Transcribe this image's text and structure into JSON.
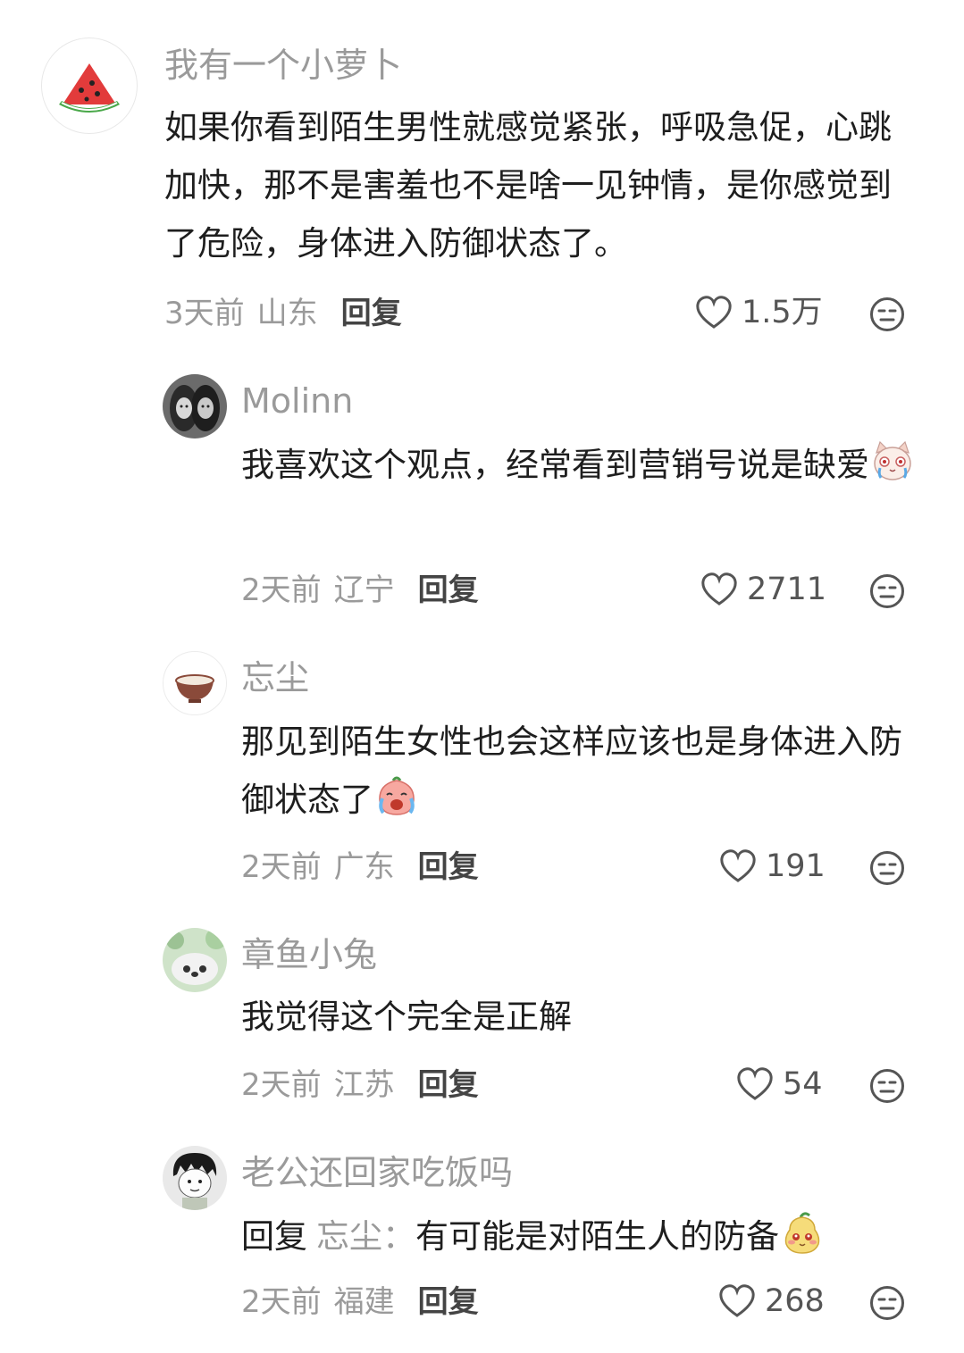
{
  "comments": [
    {
      "username": "我有一个小萝卜",
      "text": "如果你看到陌生男性就感觉紧张，呼吸急促，心跳加快，那不是害羞也不是啥一见钟情，是你感觉到了危险，身体进入防御状态了。",
      "time": "3天前",
      "location": "山东",
      "reply_label": "回复",
      "likes": "1.5万",
      "avatar_icon": "watermelon-icon"
    }
  ],
  "replies": [
    {
      "username": "Molinn",
      "text": "我喜欢这个观点，经常看到营销号说是缺爱",
      "emoji": "crying-cat-emoji",
      "time": "2天前",
      "location": "辽宁",
      "reply_label": "回复",
      "likes": "2711",
      "avatar_icon": "two-women-photo"
    },
    {
      "username": "忘尘",
      "text": "那见到陌生女性也会这样应该也是身体进入防御状态了",
      "emoji": "crying-face-emoji",
      "time": "2天前",
      "location": "广东",
      "reply_label": "回复",
      "likes": "191",
      "avatar_icon": "bowl-icon"
    },
    {
      "username": "章鱼小兔",
      "text": "我觉得这个完全是正解",
      "time": "2天前",
      "location": "江苏",
      "reply_label": "回复",
      "likes": "54",
      "avatar_icon": "plush-toy-photo"
    },
    {
      "username": "老公还回家吃饭吗",
      "reply_prefix": "回复",
      "mention": "忘尘：",
      "text": "有可能是对陌生人的防备",
      "emoji": "blushing-pear-emoji",
      "time": "2天前",
      "location": "福建",
      "reply_label": "回复",
      "likes": "268",
      "avatar_icon": "cartoon-boy-avatar"
    }
  ],
  "colors": {
    "username": "#9a9a9a",
    "text": "#1e1e1e",
    "meta": "#9a9a9a",
    "icon": "#555555"
  }
}
